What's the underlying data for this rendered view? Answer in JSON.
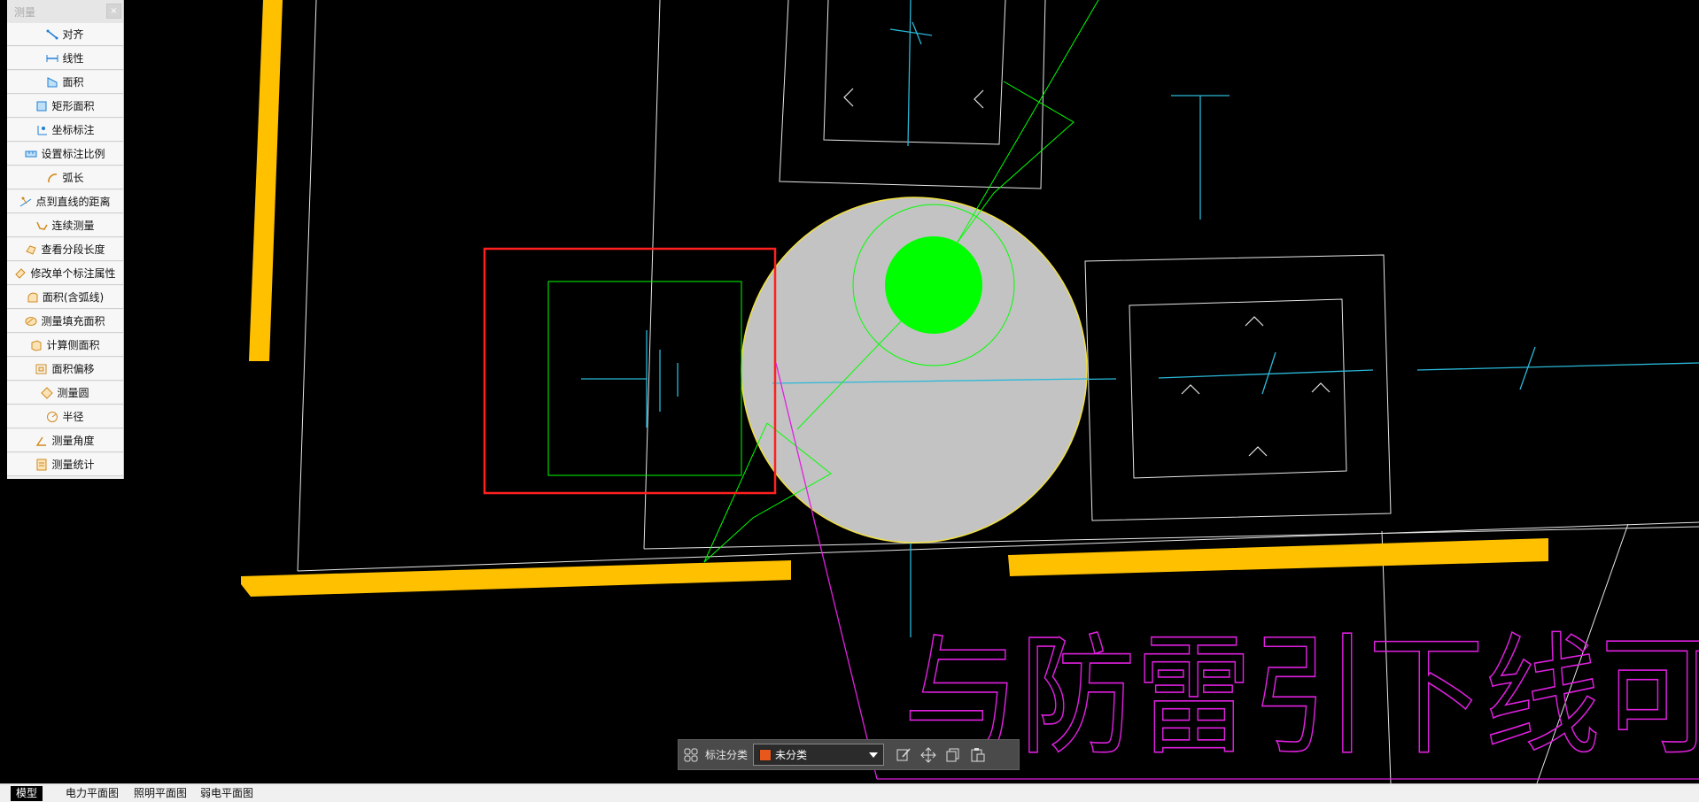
{
  "measure_panel": {
    "title": "测量",
    "close_glyph": "×",
    "tools": [
      {
        "label": "对齐",
        "icon": "aligned-dimension-icon"
      },
      {
        "label": "线性",
        "icon": "linear-dimension-icon"
      },
      {
        "label": "面积",
        "icon": "area-icon"
      },
      {
        "label": "矩形面积",
        "icon": "rectangle-area-icon"
      },
      {
        "label": "坐标标注",
        "icon": "coordinate-icon"
      },
      {
        "label": "设置标注比例",
        "icon": "dimension-scale-icon"
      },
      {
        "label": "弧长",
        "icon": "arc-length-icon"
      },
      {
        "label": "点到直线的距离",
        "icon": "point-to-line-icon"
      },
      {
        "label": "连续测量",
        "icon": "continuous-measure-icon"
      },
      {
        "label": "查看分段长度",
        "icon": "segment-length-icon"
      },
      {
        "label": "修改单个标注属性",
        "icon": "edit-dimension-icon"
      },
      {
        "label": "面积(含弧线)",
        "icon": "arc-area-icon"
      },
      {
        "label": "测量填充面积",
        "icon": "hatch-area-icon"
      },
      {
        "label": "计算侧面积",
        "icon": "side-area-icon"
      },
      {
        "label": "面积偏移",
        "icon": "area-offset-icon"
      },
      {
        "label": "测量圆",
        "icon": "measure-circle-icon"
      },
      {
        "label": "半径",
        "icon": "radius-icon"
      },
      {
        "label": "测量角度",
        "icon": "measure-angle-icon"
      },
      {
        "label": "测量统计",
        "icon": "measure-statistics-icon"
      }
    ]
  },
  "dim_toolbar": {
    "label": "标注分类",
    "category_value": "未分类",
    "category_color": "#e8581c"
  },
  "drawing": {
    "annotation_text": "与防雷引下线可靠焊"
  },
  "colors": {
    "background": "#000000",
    "wall": "#ffc000",
    "selection": "#ff2020",
    "green": "#00ff00",
    "cyan": "#2ab8d8",
    "magenta": "#e020e0",
    "circle_fill": "#c3c3c3"
  },
  "tabs": [
    {
      "label": "模型",
      "active": true
    },
    {
      "label": "电力平面图",
      "active": false
    },
    {
      "label": "照明平面图",
      "active": false
    },
    {
      "label": "弱电平面图",
      "active": false
    }
  ]
}
